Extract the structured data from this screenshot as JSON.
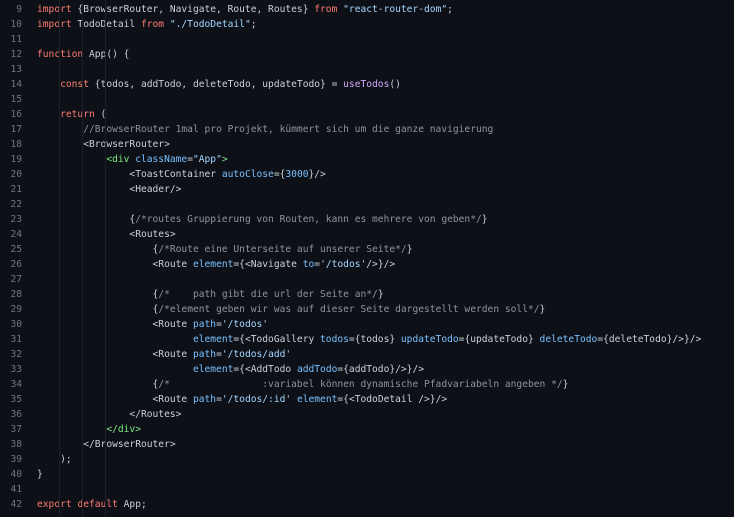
{
  "lines": [
    {
      "num": "9",
      "indent": "",
      "tokens": [
        [
          "k",
          "import"
        ],
        [
          "p",
          " {BrowserRouter, Navigate, Route, Routes} "
        ],
        [
          "k",
          "from"
        ],
        [
          "p",
          " "
        ],
        [
          "s",
          "\"react-router-dom\""
        ],
        [
          "p",
          ";"
        ]
      ]
    },
    {
      "num": "10",
      "indent": "",
      "tokens": [
        [
          "k",
          "import"
        ],
        [
          "p",
          " TodoDetail "
        ],
        [
          "k",
          "from"
        ],
        [
          "p",
          " "
        ],
        [
          "s",
          "\"./TodoDetail\""
        ],
        [
          "p",
          ";"
        ]
      ]
    },
    {
      "num": "11",
      "indent": "",
      "tokens": []
    },
    {
      "num": "12",
      "indent": "",
      "tokens": [
        [
          "k",
          "function"
        ],
        [
          "p",
          " App() {"
        ]
      ]
    },
    {
      "num": "13",
      "indent": "",
      "tokens": []
    },
    {
      "num": "14",
      "indent": "    ",
      "tokens": [
        [
          "k",
          "const"
        ],
        [
          "p",
          " {todos, addTodo, deleteTodo, updateTodo} = "
        ],
        [
          "f",
          "useTodos"
        ],
        [
          "p",
          "()"
        ]
      ]
    },
    {
      "num": "15",
      "indent": "",
      "tokens": []
    },
    {
      "num": "16",
      "indent": "    ",
      "tokens": [
        [
          "k",
          "return"
        ],
        [
          "p",
          " ("
        ]
      ]
    },
    {
      "num": "17",
      "indent": "        ",
      "tokens": [
        [
          "c",
          "//BrowserRouter 1mal pro Projekt, kümmert sich um die ganze navigierung"
        ]
      ]
    },
    {
      "num": "18",
      "indent": "        ",
      "tokens": [
        [
          "p",
          "<BrowserRouter>"
        ]
      ]
    },
    {
      "num": "19",
      "indent": "            ",
      "tokens": [
        [
          "t",
          "<div"
        ],
        [
          "p",
          " "
        ],
        [
          "a",
          "className"
        ],
        [
          "p",
          "="
        ],
        [
          "s",
          "\"App\""
        ],
        [
          "t",
          ">"
        ]
      ]
    },
    {
      "num": "20",
      "indent": "                ",
      "tokens": [
        [
          "p",
          "<ToastContainer "
        ],
        [
          "a",
          "autoClose"
        ],
        [
          "p",
          "={"
        ],
        [
          "n",
          "3000"
        ],
        [
          "p",
          "}/>"
        ]
      ]
    },
    {
      "num": "21",
      "indent": "                ",
      "tokens": [
        [
          "p",
          "<Header/>"
        ]
      ]
    },
    {
      "num": "22",
      "indent": "",
      "tokens": []
    },
    {
      "num": "23",
      "indent": "                ",
      "tokens": [
        [
          "p",
          "{"
        ],
        [
          "c",
          "/*routes Gruppierung von Routen, kann es mehrere von geben*/"
        ],
        [
          "p",
          "}"
        ]
      ]
    },
    {
      "num": "24",
      "indent": "                ",
      "tokens": [
        [
          "p",
          "<Routes>"
        ]
      ]
    },
    {
      "num": "25",
      "indent": "                    ",
      "tokens": [
        [
          "p",
          "{"
        ],
        [
          "c",
          "/*Route eine Unterseite auf unserer Seite*/"
        ],
        [
          "p",
          "}"
        ]
      ]
    },
    {
      "num": "26",
      "indent": "                    ",
      "tokens": [
        [
          "p",
          "<Route "
        ],
        [
          "a",
          "element"
        ],
        [
          "p",
          "={<Navigate "
        ],
        [
          "a",
          "to"
        ],
        [
          "p",
          "="
        ],
        [
          "s",
          "'/todos'"
        ],
        [
          "p",
          "/>}/>"
        ]
      ]
    },
    {
      "num": "27",
      "indent": "",
      "tokens": []
    },
    {
      "num": "28",
      "indent": "                    ",
      "tokens": [
        [
          "p",
          "{"
        ],
        [
          "c",
          "/*    path gibt die url der Seite an*/"
        ],
        [
          "p",
          "}"
        ]
      ]
    },
    {
      "num": "29",
      "indent": "                    ",
      "tokens": [
        [
          "p",
          "{"
        ],
        [
          "c",
          "/*element geben wir was auf dieser Seite dargestellt werden soll*/"
        ],
        [
          "p",
          "}"
        ]
      ]
    },
    {
      "num": "30",
      "indent": "                    ",
      "tokens": [
        [
          "p",
          "<Route "
        ],
        [
          "a",
          "path"
        ],
        [
          "p",
          "="
        ],
        [
          "s",
          "'/todos'"
        ]
      ]
    },
    {
      "num": "31",
      "indent": "                           ",
      "tokens": [
        [
          "a",
          "element"
        ],
        [
          "p",
          "={<TodoGallery "
        ],
        [
          "a",
          "todos"
        ],
        [
          "p",
          "={todos} "
        ],
        [
          "a",
          "updateTodo"
        ],
        [
          "p",
          "={updateTodo} "
        ],
        [
          "a",
          "deleteTodo"
        ],
        [
          "p",
          "={deleteTodo}/>}/>"
        ]
      ]
    },
    {
      "num": "32",
      "indent": "                    ",
      "tokens": [
        [
          "p",
          "<Route "
        ],
        [
          "a",
          "path"
        ],
        [
          "p",
          "="
        ],
        [
          "s",
          "'/todos/add'"
        ]
      ]
    },
    {
      "num": "33",
      "indent": "                           ",
      "tokens": [
        [
          "a",
          "element"
        ],
        [
          "p",
          "={<AddTodo "
        ],
        [
          "a",
          "addTodo"
        ],
        [
          "p",
          "={addTodo}/>}/>"
        ]
      ]
    },
    {
      "num": "34",
      "indent": "                    ",
      "tokens": [
        [
          "p",
          "{"
        ],
        [
          "c",
          "/*                :variabel können dynamische Pfadvariabeln angeben */"
        ],
        [
          "p",
          "}"
        ]
      ]
    },
    {
      "num": "35",
      "indent": "                    ",
      "tokens": [
        [
          "p",
          "<Route "
        ],
        [
          "a",
          "path"
        ],
        [
          "p",
          "="
        ],
        [
          "s",
          "'/todos/:id'"
        ],
        [
          "p",
          " "
        ],
        [
          "a",
          "element"
        ],
        [
          "p",
          "={<TodoDetail />}/>"
        ]
      ]
    },
    {
      "num": "36",
      "indent": "                ",
      "tokens": [
        [
          "p",
          "</Routes>"
        ]
      ]
    },
    {
      "num": "37",
      "indent": "            ",
      "tokens": [
        [
          "t",
          "</div>"
        ]
      ]
    },
    {
      "num": "38",
      "indent": "        ",
      "tokens": [
        [
          "p",
          "</BrowserRouter>"
        ]
      ]
    },
    {
      "num": "39",
      "indent": "    ",
      "tokens": [
        [
          "p",
          ");"
        ]
      ]
    },
    {
      "num": "40",
      "indent": "",
      "tokens": [
        [
          "p",
          "}"
        ]
      ]
    },
    {
      "num": "41",
      "indent": "",
      "tokens": []
    },
    {
      "num": "42",
      "indent": "",
      "tokens": [
        [
          "k",
          "export"
        ],
        [
          "p",
          " "
        ],
        [
          "k",
          "default"
        ],
        [
          "p",
          " App;"
        ]
      ]
    }
  ]
}
